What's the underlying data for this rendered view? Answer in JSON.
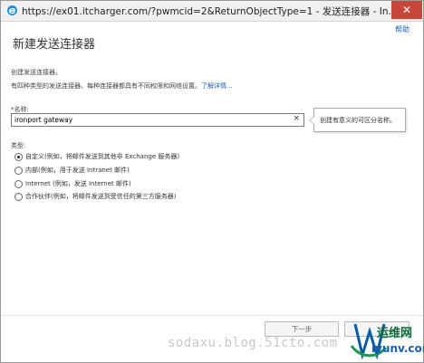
{
  "window": {
    "title": "https://ex01.itcharger.com/?pwmcid=2&ReturnObjectType=1 - 发送连接器 - In...",
    "close_glyph": "✕"
  },
  "header": {
    "help": "帮助",
    "title": "新建发送连接器"
  },
  "intro": {
    "line1": "创建发送连接器。",
    "line2": "有四种类型的发送连接器。每种连接器都具有不同权限和网络设置。",
    "learn_more": "了解详情..."
  },
  "name_field": {
    "label": "*名称:",
    "value": "ironport gateway",
    "clear_glyph": "×",
    "tooltip": "创建有意义的可区分名称。"
  },
  "type": {
    "label": "类型:",
    "options": [
      {
        "label": "自定义(例如，将邮件发送到其他非 Exchange 服务器)",
        "selected": true
      },
      {
        "label": "内部(例如，用于发送 Intranet 邮件)",
        "selected": false
      },
      {
        "label": "Internet (例如，发送 Internet 邮件)",
        "selected": false
      },
      {
        "label": "合作伙伴(例如，将邮件发送到受信任的第三方服务器)",
        "selected": false
      }
    ]
  },
  "footer": {
    "next": "下一步",
    "watermark": "sodaxu.blog.51cto.com",
    "logo_main": "运维网",
    "logo_sub": "iyunv.com"
  },
  "colors": {
    "link": "#1a62b8",
    "close": "#c7463b",
    "logo_green": "#0a6a3a"
  }
}
